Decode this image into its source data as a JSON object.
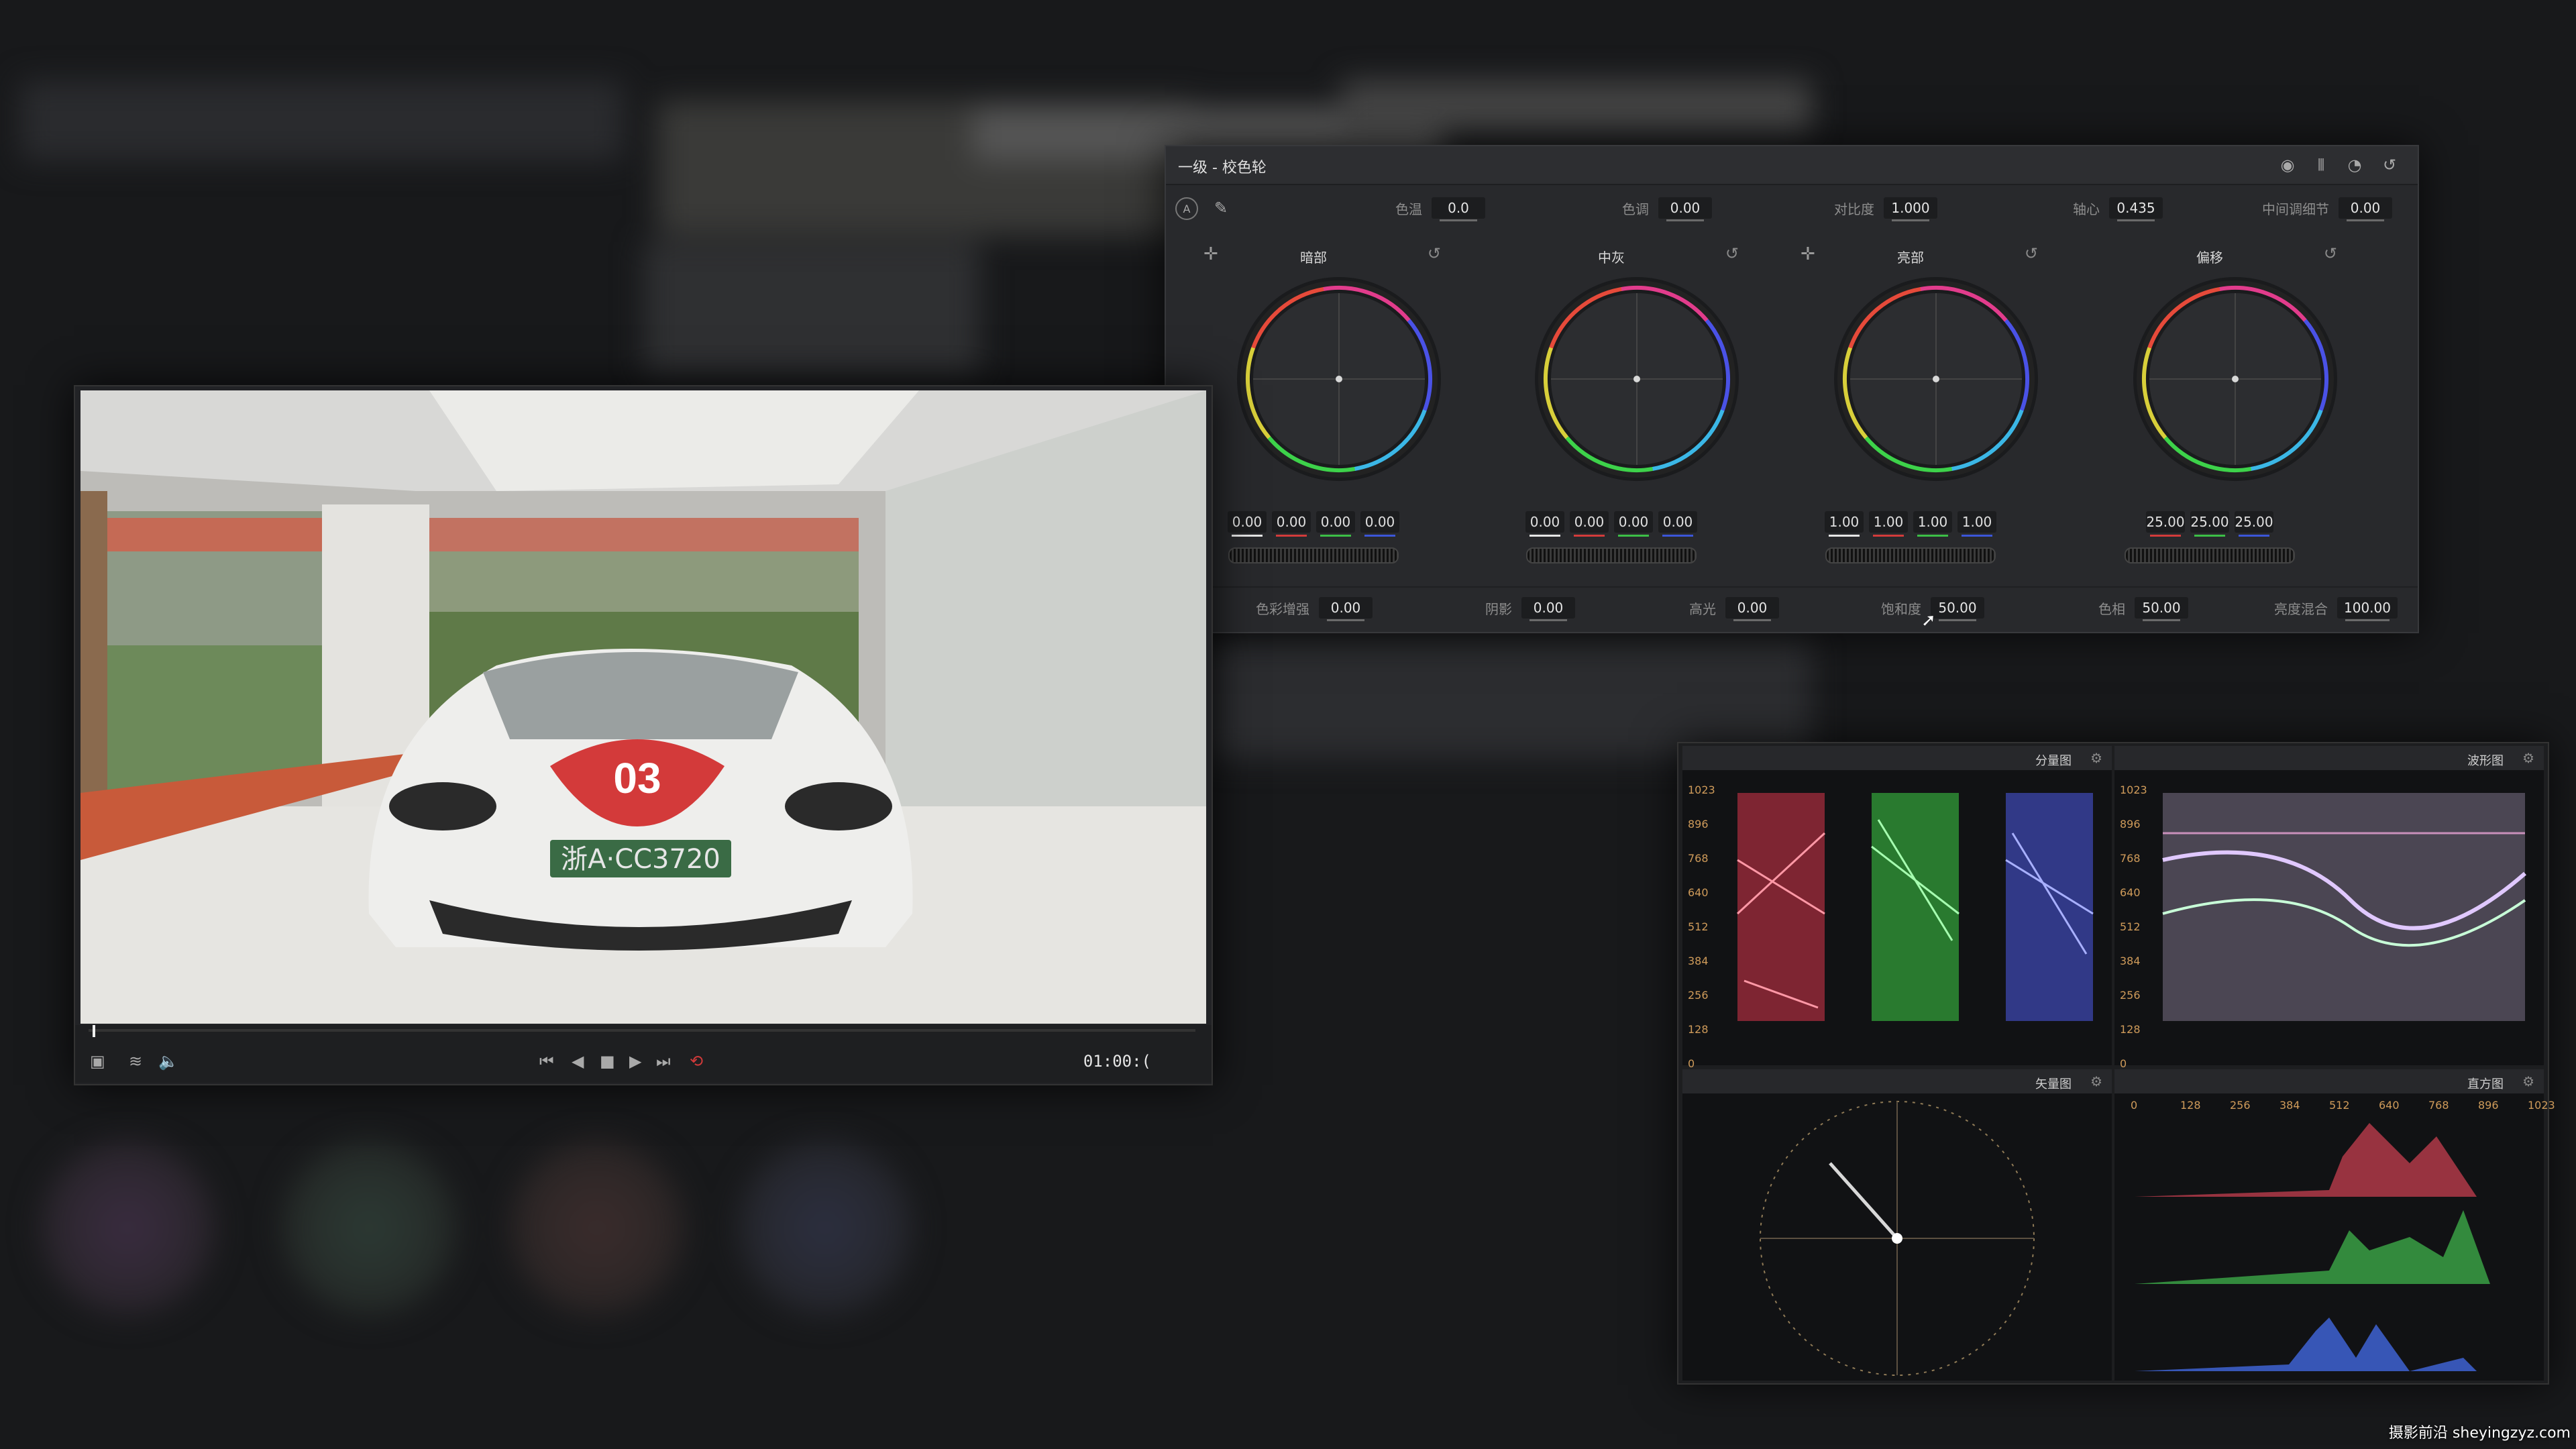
{
  "panel": {
    "title": "一级 - 校色轮",
    "params_top": [
      {
        "label": "色温",
        "value": "0.0"
      },
      {
        "label": "色调",
        "value": "0.00"
      },
      {
        "label": "对比度",
        "value": "1.000"
      },
      {
        "label": "轴心",
        "value": "0.435"
      },
      {
        "label": "中间调细节",
        "value": "0.00"
      }
    ],
    "wheels": [
      {
        "title": "暗部",
        "values": [
          "0.00",
          "0.00",
          "0.00",
          "0.00"
        ]
      },
      {
        "title": "中灰",
        "values": [
          "0.00",
          "0.00",
          "0.00",
          "0.00"
        ]
      },
      {
        "title": "亮部",
        "values": [
          "1.00",
          "1.00",
          "1.00",
          "1.00"
        ]
      },
      {
        "title": "偏移",
        "values": [
          "25.00",
          "25.00",
          "25.00"
        ]
      }
    ],
    "params_bottom": [
      {
        "label": "色彩增强",
        "value": "0.00"
      },
      {
        "label": "阴影",
        "value": "0.00"
      },
      {
        "label": "高光",
        "value": "0.00"
      },
      {
        "label": "饱和度",
        "value": "50.00"
      },
      {
        "label": "色相",
        "value": "50.00"
      },
      {
        "label": "亮度混合",
        "value": "100.00"
      }
    ]
  },
  "viewer": {
    "timecode": "01:00:(",
    "car_badge": "03",
    "license_plate": "浙A·CC3720"
  },
  "scopes": {
    "parade": {
      "name": "分量图",
      "ticks": [
        "1023",
        "896",
        "768",
        "640",
        "512",
        "384",
        "256",
        "128",
        "0"
      ]
    },
    "waveform": {
      "name": "波形图",
      "ticks": [
        "1023",
        "896",
        "768",
        "640",
        "512",
        "384",
        "256",
        "128",
        "0"
      ]
    },
    "vectorscope": {
      "name": "矢量图"
    },
    "histogram": {
      "name": "直方图",
      "ticks": [
        "0",
        "128",
        "256",
        "384",
        "512",
        "640",
        "768",
        "896",
        "1023"
      ]
    }
  },
  "watermark": "摄影前沿 sheyingzyz.com"
}
